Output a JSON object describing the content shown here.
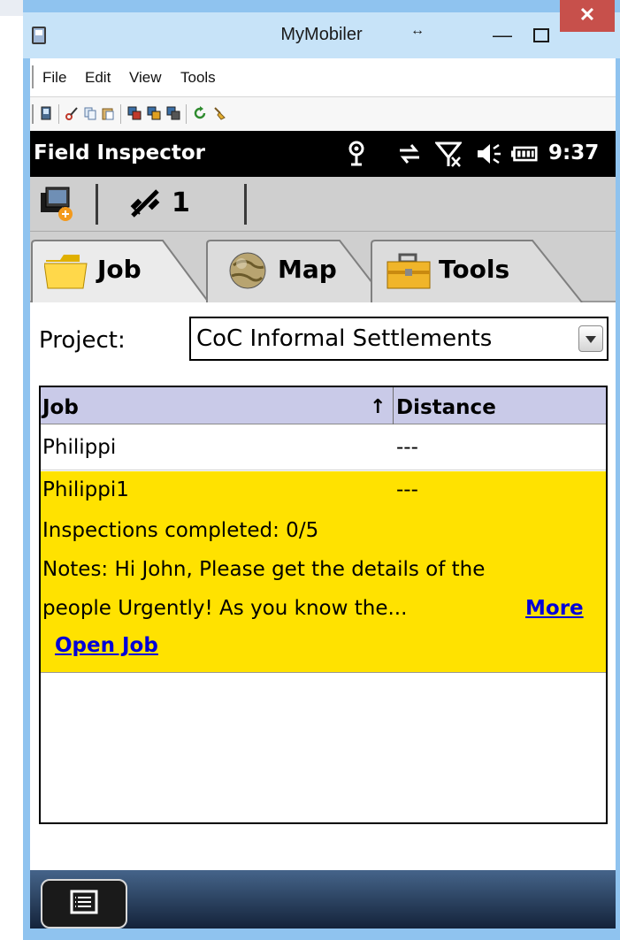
{
  "window": {
    "title": "MyMobiler",
    "close_glyph": "✕",
    "minimize_glyph": "—",
    "resize_glyph": "↔"
  },
  "menubar": {
    "items": [
      "File",
      "Edit",
      "View",
      "Tools"
    ]
  },
  "device": {
    "status_title": "Field Inspector",
    "time": "9:37",
    "satellite_count": "1"
  },
  "tabs": [
    {
      "label": "Job",
      "icon": "folder-icon",
      "active": true
    },
    {
      "label": "Map",
      "icon": "globe-icon",
      "active": false
    },
    {
      "label": "Tools",
      "icon": "toolbox-icon",
      "active": false
    }
  ],
  "project": {
    "label": "Project:",
    "value": "CoC Informal Settlements"
  },
  "grid": {
    "col_job": "Job",
    "sort_arrow": "↑",
    "col_distance": "Distance",
    "rows": [
      {
        "job": "Philippi",
        "distance": "---"
      },
      {
        "job": "Philippi1",
        "distance": "---",
        "inspections": "Inspections completed: 0/5",
        "notes_line1": "Notes: Hi John, Please get the details of the",
        "notes_line2": "people Urgently!  As you know the...",
        "more_link": "More",
        "open_link": "Open Job"
      }
    ]
  },
  "colors": {
    "selected_row": "#ffe200",
    "header_bg": "#c9cae8",
    "link": "#0000d8",
    "close_button": "#c7504b"
  }
}
